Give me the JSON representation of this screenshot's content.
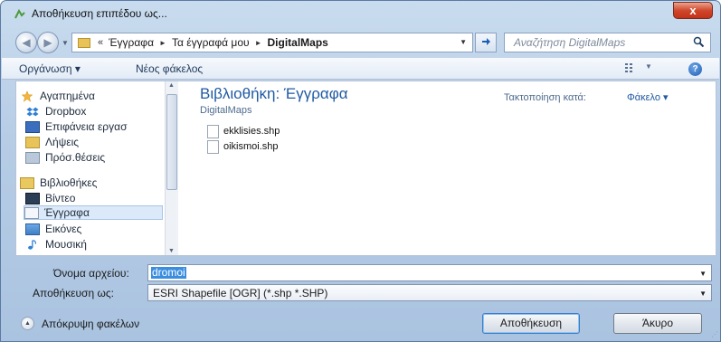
{
  "window": {
    "title": "Αποθήκευση επιπέδου ως...",
    "close_label": "x"
  },
  "address": {
    "chevron": "«",
    "crumbs": [
      "Έγγραφα",
      "Τα έγγραφά μου",
      "DigitalMaps"
    ],
    "separator": "►"
  },
  "search": {
    "placeholder": "Αναζήτηση DigitalMaps"
  },
  "toolbar": {
    "organize": "Οργάνωση ▾",
    "new_folder": "Νέος φάκελος"
  },
  "nav": {
    "favorites": "Αγαπημένα",
    "items_fav": [
      "Dropbox",
      "Επιφάνεια εργασ",
      "Λήψεις",
      "Πρόσ.θέσεις"
    ],
    "libraries": "Βιβλιοθήκες",
    "items_lib": [
      "Βίντεο",
      "Έγγραφα",
      "Εικόνες",
      "Μουσική"
    ],
    "selected": "Έγγραφα"
  },
  "files_pane": {
    "title": "Βιβλιοθήκη: Έγγραφα",
    "subtitle": "DigitalMaps",
    "arrange_label": "Τακτοποίηση κατά:",
    "arrange_value": "Φάκελο ▾",
    "files": [
      "ekklisies.shp",
      "oikismoi.shp"
    ]
  },
  "form": {
    "filename_label": "Όνομα αρχείου:",
    "filename_value": "dromoi",
    "filetype_label": "Αποθήκευση ως:",
    "filetype_value": "ESRI Shapefile [OGR] (*.shp *.SHP)"
  },
  "footer": {
    "hide_folders": "Απόκρυψη φακέλων",
    "save": "Αποθήκευση",
    "cancel": "Άκυρο"
  },
  "colors": {
    "accent": "#1f5aa3",
    "selection": "#3b8de0",
    "close": "#d0472c"
  }
}
